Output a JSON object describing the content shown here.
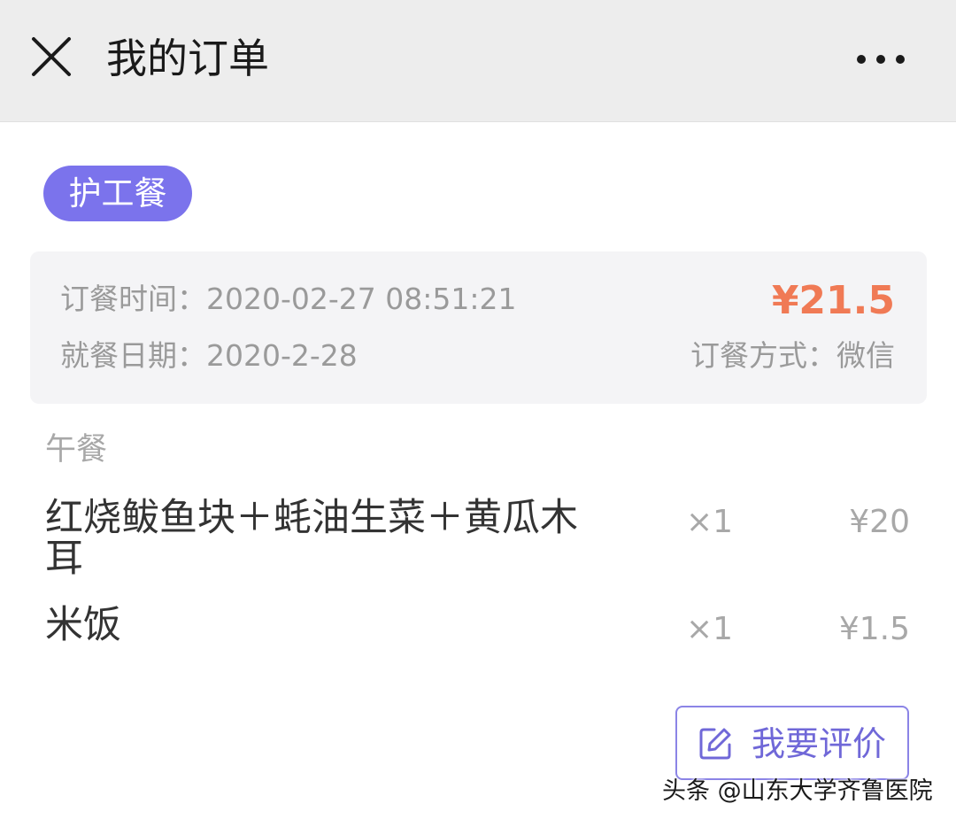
{
  "header": {
    "title": "我的订单",
    "close_icon": "close-icon",
    "more_icon": "more-horizontal-icon"
  },
  "order": {
    "category_tag": "护工餐",
    "order_time_label": "订餐时间：",
    "order_time": "2020-02-27 08:51:21",
    "meal_date_label": "就餐日期：",
    "meal_date": "2020-2-28",
    "total": "¥21.5",
    "payment_label": "订餐方式：",
    "payment_method": "微信"
  },
  "meal": {
    "label": "午餐",
    "items": [
      {
        "name": "红烧鲅鱼块＋蚝油生菜＋黄瓜木耳",
        "qty": "×1",
        "price": "¥20"
      },
      {
        "name": "米饭",
        "qty": "×1",
        "price": "¥1.5"
      }
    ]
  },
  "actions": {
    "review_label": "我要评价",
    "review_icon": "edit-icon"
  },
  "watermark": "头条 @山东大学齐鲁医院",
  "colors": {
    "header_bg": "#ededed",
    "accent": "#7b73ec",
    "price_accent": "#f07a55",
    "card_bg": "#f4f4f6"
  }
}
